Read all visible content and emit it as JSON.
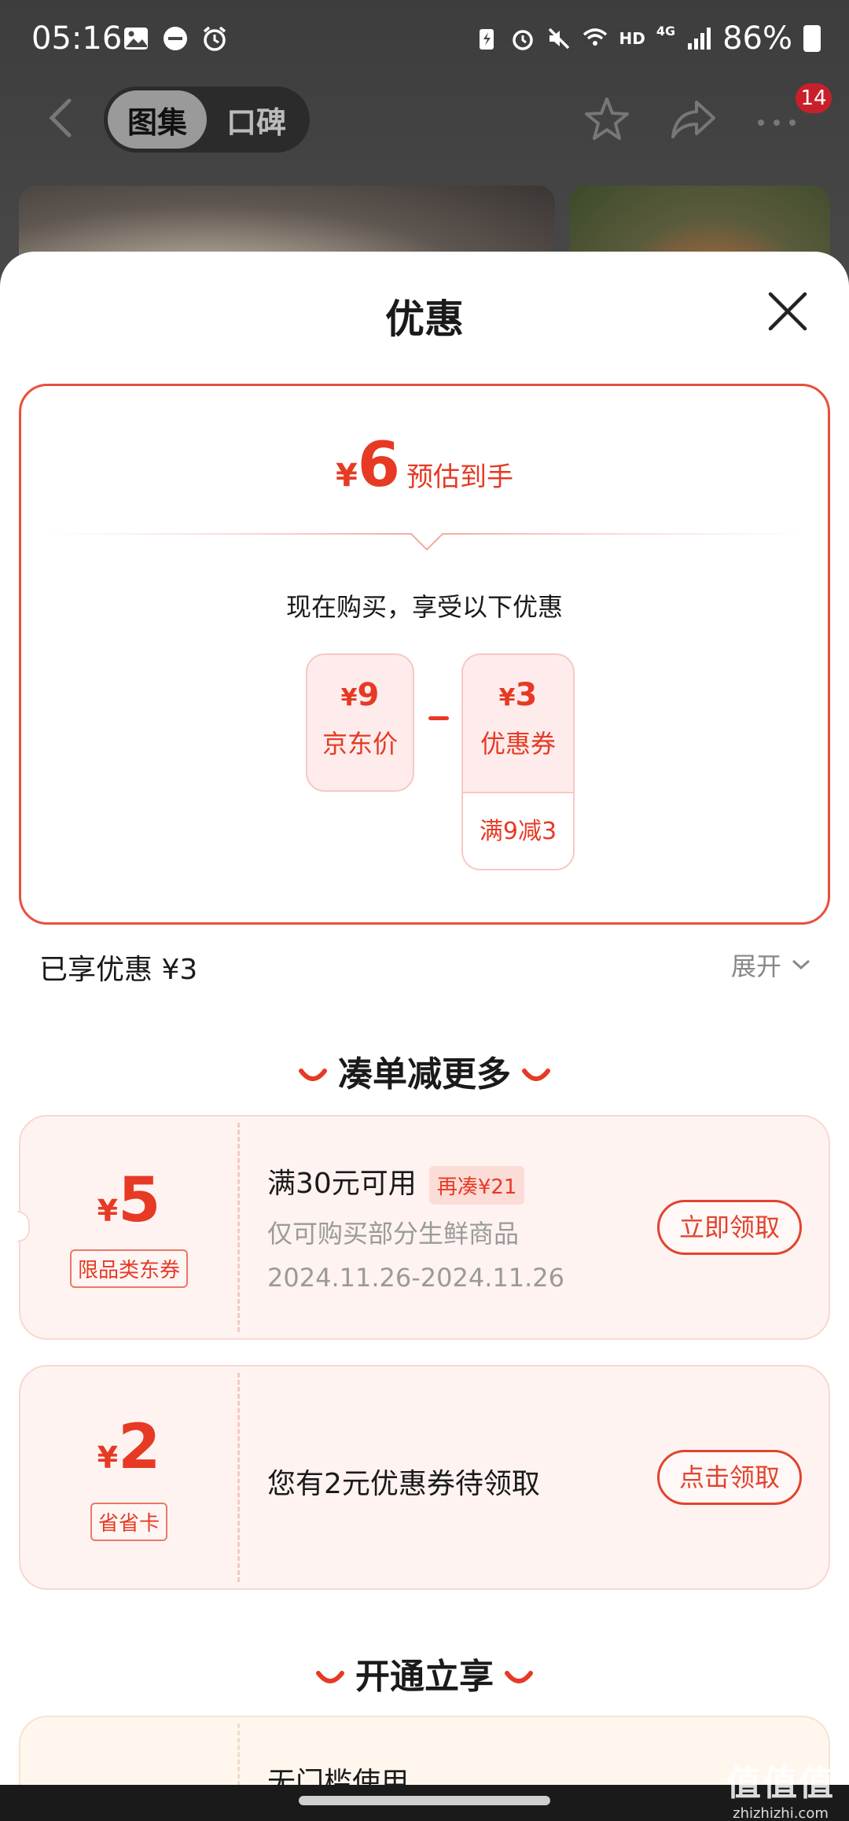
{
  "status_bar": {
    "time": "05:16",
    "battery": "86%",
    "hd": "HD",
    "network": "4G"
  },
  "nav": {
    "tabs": [
      {
        "label": "图集",
        "active": true
      },
      {
        "label": "口碑",
        "active": false
      }
    ],
    "notification_count": "14"
  },
  "sheet": {
    "title": "优惠",
    "estimate": {
      "currency": "¥",
      "amount": "6",
      "label": "预估到手",
      "subtitle": "现在购买，享受以下优惠",
      "jd_price": {
        "currency": "¥",
        "value": "9",
        "label": "京东价"
      },
      "coupon": {
        "currency": "¥",
        "value": "3",
        "label": "优惠券",
        "condition": "满9减3"
      }
    },
    "enjoyed": "已享优惠 ¥3",
    "expand_label": "展开",
    "section_more": "凑单减更多",
    "coupons": [
      {
        "currency": "¥",
        "amount": "5",
        "tag": "限品类东券",
        "title": "满30元可用",
        "extra_tag": "再凑¥21",
        "desc": "仅可购买部分生鲜商品",
        "date": "2024.11.26-2024.11.26",
        "button": "立即领取"
      },
      {
        "currency": "¥",
        "amount": "2",
        "tag": "省省卡",
        "title": "您有2元优惠券待领取",
        "button": "点击领取"
      }
    ],
    "section_open": "开通立享",
    "partial_card_text": "无门槛使用"
  },
  "watermark": {
    "logo": "值值值",
    "site": "zhizhizhi.com"
  },
  "colors": {
    "accent": "#e63a25",
    "card_bg": "#fff3f1",
    "badge": "#c8202a"
  }
}
